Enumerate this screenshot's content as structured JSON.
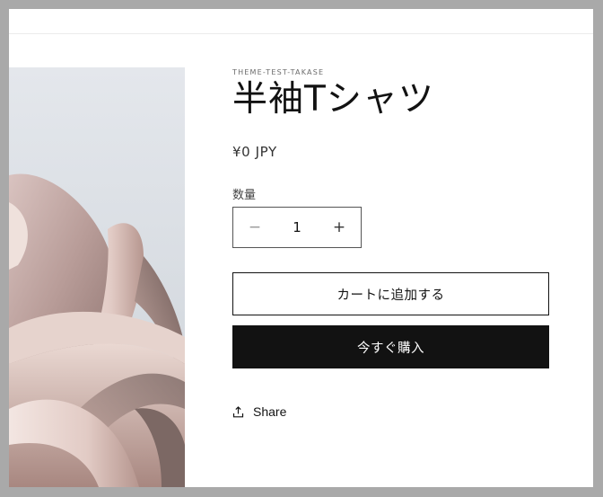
{
  "product": {
    "vendor": "THEME-TEST-TAKASE",
    "title": "半袖Tシャツ",
    "price": "¥0 JPY",
    "quantity_label": "数量",
    "quantity_value": "1",
    "minus_symbol": "−",
    "plus_symbol": "+",
    "add_to_cart_label": "カートに追加する",
    "buy_now_label": "今すぐ購入",
    "share_label": "Share"
  },
  "icons": {
    "share": "share-icon",
    "minus": "minus-icon",
    "plus": "plus-icon"
  },
  "colors": {
    "primary": "#121212",
    "background": "#ffffff",
    "frame": "#a9a9a9"
  }
}
